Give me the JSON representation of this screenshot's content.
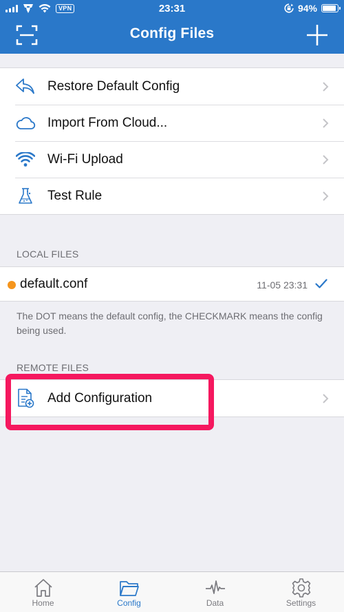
{
  "status_bar": {
    "time": "23:31",
    "vpn": "VPN",
    "battery": "94%"
  },
  "nav": {
    "title": "Config Files"
  },
  "menu": [
    {
      "label": "Restore Default Config",
      "icon": "restore-arrow-icon"
    },
    {
      "label": "Import From Cloud...",
      "icon": "cloud-icon"
    },
    {
      "label": "Wi-Fi Upload",
      "icon": "wifi-icon"
    },
    {
      "label": "Test Rule",
      "icon": "flask-icon"
    }
  ],
  "local_files": {
    "header": "LOCAL FILES",
    "file": {
      "name": "default.conf",
      "date": "11-05 23:31"
    },
    "footnote": "The DOT means the default config, the CHECKMARK means the config being used."
  },
  "remote_files": {
    "header": "REMOTE FILES",
    "add_label": "Add Configuration"
  },
  "tabs": [
    {
      "label": "Home",
      "icon": "home-icon"
    },
    {
      "label": "Config",
      "icon": "folder-icon"
    },
    {
      "label": "Data",
      "icon": "pulse-icon"
    },
    {
      "label": "Settings",
      "icon": "gear-icon"
    }
  ],
  "colors": {
    "accent": "#2a78c9",
    "default_dot": "#f5951c",
    "highlight": "#f5185f"
  }
}
